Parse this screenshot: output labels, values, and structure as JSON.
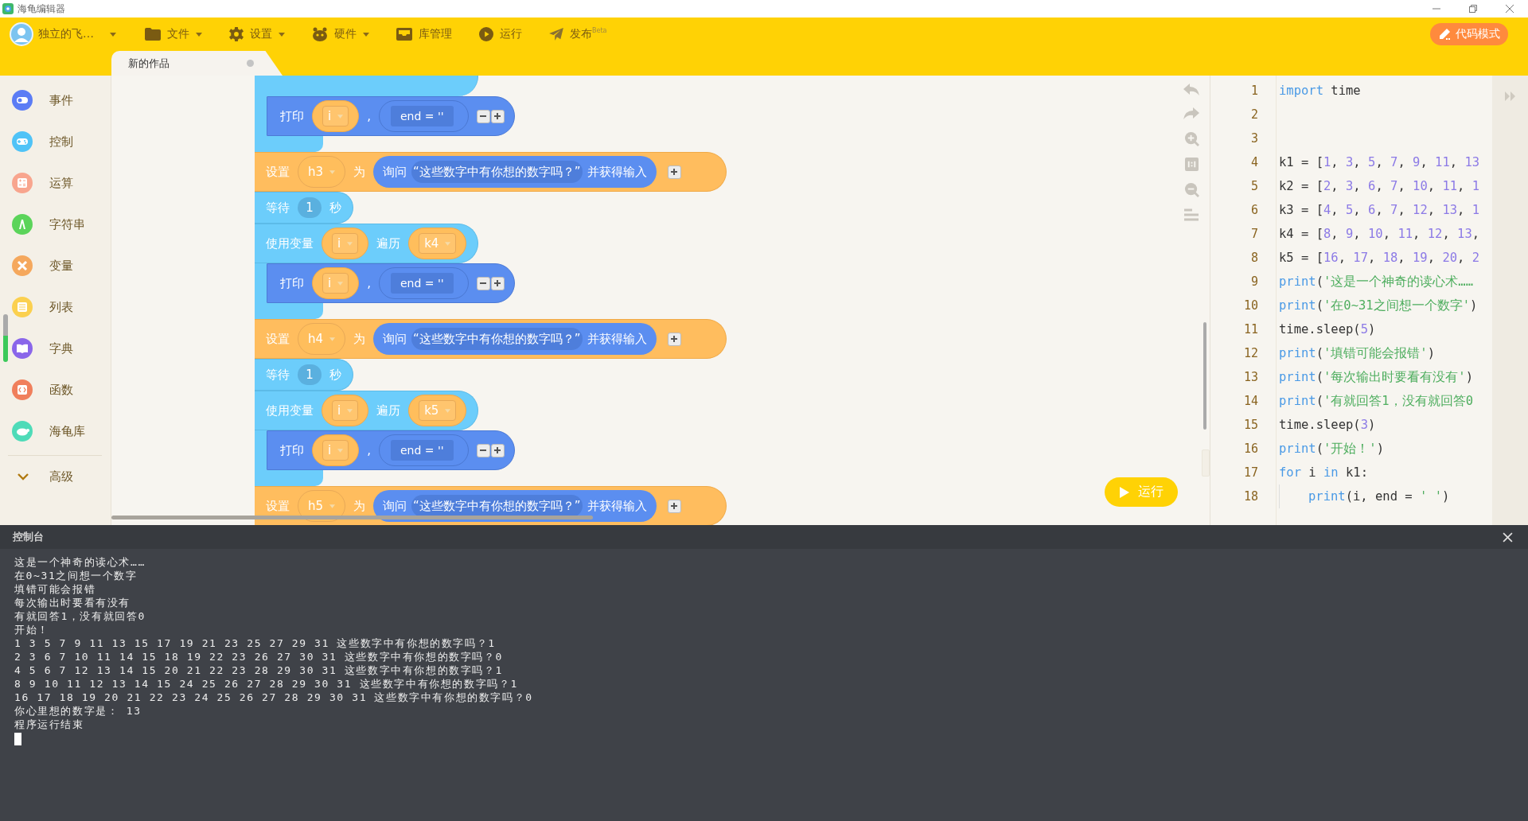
{
  "window": {
    "title": "海龟编辑器"
  },
  "toolbar": {
    "user": "独立的飞…",
    "menus": [
      {
        "label": "文件",
        "dropdown": true
      },
      {
        "label": "设置",
        "dropdown": true
      },
      {
        "label": "硬件",
        "dropdown": true
      },
      {
        "label": "库管理",
        "dropdown": false
      },
      {
        "label": "运行",
        "dropdown": false
      },
      {
        "label": "发布$^{Beta}$",
        "dropdown": false
      }
    ],
    "mode_button": "代码模式"
  },
  "tabs": [
    {
      "label": "新的作品",
      "selected": true
    }
  ],
  "sidebar": {
    "items": [
      {
        "label": "事件",
        "color": "#5b7cf5"
      },
      {
        "label": "控制",
        "color": "#4fc3f7"
      },
      {
        "label": "运算",
        "color": "#f8a58e"
      },
      {
        "label": "字符串",
        "color": "#5bd45a"
      },
      {
        "label": "变量",
        "color": "#f5a85d"
      },
      {
        "label": "列表",
        "color": "#fbd04f"
      },
      {
        "label": "字典",
        "color": "#8a66ea"
      },
      {
        "label": "函数",
        "color": "#f07f5c"
      },
      {
        "label": "海龟库",
        "color": "#4edbb8"
      }
    ],
    "more": "高级"
  },
  "blocks": [
    {
      "kind": "loop_tail",
      "body": [
        {
          "kind": "print",
          "label": "打印",
          "var": "i",
          "sep": ",",
          "end": "end = ''"
        }
      ]
    },
    {
      "kind": "set",
      "label": "设置",
      "var": "h3",
      "to": "为",
      "ask": "询问",
      "prompt": "“这些数字中有你想的数字吗？”",
      "suffix": "并获得输入"
    },
    {
      "kind": "wait",
      "label": "等待",
      "value": "1",
      "unit": "秒"
    },
    {
      "kind": "loop",
      "label": "使用变量",
      "var": "i",
      "over": "遍历",
      "list": "k4",
      "body": [
        {
          "kind": "print",
          "label": "打印",
          "var": "i",
          "sep": ",",
          "end": "end = ''"
        }
      ]
    },
    {
      "kind": "set",
      "label": "设置",
      "var": "h4",
      "to": "为",
      "ask": "询问",
      "prompt": "“这些数字中有你想的数字吗？”",
      "suffix": "并获得输入"
    },
    {
      "kind": "wait",
      "label": "等待",
      "value": "1",
      "unit": "秒"
    },
    {
      "kind": "loop",
      "label": "使用变量",
      "var": "i",
      "over": "遍历",
      "list": "k5",
      "body": [
        {
          "kind": "print",
          "label": "打印",
          "var": "i",
          "sep": ",",
          "end": "end = ''"
        }
      ]
    },
    {
      "kind": "set",
      "label": "设置",
      "var": "h5",
      "to": "为",
      "ask": "询问",
      "prompt": "“这些数字中有你想的数字吗？”",
      "suffix": "并获得输入"
    }
  ],
  "run_button": "运行",
  "code": {
    "lines": [
      {
        "number": "1",
        "tokens": [
          {
            "kind": "kw",
            "text": "import"
          },
          {
            "kind": "p",
            "text": " time"
          }
        ]
      },
      {
        "number": "2"
      },
      {
        "number": "3"
      },
      {
        "number": "4",
        "tokens": [
          {
            "kind": "p",
            "text": "k1 = ["
          },
          {
            "kind": "n",
            "text": "1"
          },
          {
            "kind": "p",
            "text": ", "
          },
          {
            "kind": "n",
            "text": "3"
          },
          {
            "kind": "p",
            "text": ", "
          },
          {
            "kind": "n",
            "text": "5"
          },
          {
            "kind": "p",
            "text": ", "
          },
          {
            "kind": "n",
            "text": "7"
          },
          {
            "kind": "p",
            "text": ", "
          },
          {
            "kind": "n",
            "text": "9"
          },
          {
            "kind": "p",
            "text": ", "
          },
          {
            "kind": "n",
            "text": "11"
          },
          {
            "kind": "p",
            "text": ", "
          },
          {
            "kind": "n",
            "text": "13"
          }
        ]
      },
      {
        "number": "5",
        "tokens": [
          {
            "kind": "p",
            "text": "k2 = ["
          },
          {
            "kind": "n",
            "text": "2"
          },
          {
            "kind": "p",
            "text": ", "
          },
          {
            "kind": "n",
            "text": "3"
          },
          {
            "kind": "p",
            "text": ", "
          },
          {
            "kind": "n",
            "text": "6"
          },
          {
            "kind": "p",
            "text": ", "
          },
          {
            "kind": "n",
            "text": "7"
          },
          {
            "kind": "p",
            "text": ", "
          },
          {
            "kind": "n",
            "text": "10"
          },
          {
            "kind": "p",
            "text": ", "
          },
          {
            "kind": "n",
            "text": "11"
          },
          {
            "kind": "p",
            "text": ", "
          },
          {
            "kind": "n",
            "text": "1"
          }
        ]
      },
      {
        "number": "6",
        "tokens": [
          {
            "kind": "p",
            "text": "k3 = ["
          },
          {
            "kind": "n",
            "text": "4"
          },
          {
            "kind": "p",
            "text": ", "
          },
          {
            "kind": "n",
            "text": "5"
          },
          {
            "kind": "p",
            "text": ", "
          },
          {
            "kind": "n",
            "text": "6"
          },
          {
            "kind": "p",
            "text": ", "
          },
          {
            "kind": "n",
            "text": "7"
          },
          {
            "kind": "p",
            "text": ", "
          },
          {
            "kind": "n",
            "text": "12"
          },
          {
            "kind": "p",
            "text": ", "
          },
          {
            "kind": "n",
            "text": "13"
          },
          {
            "kind": "p",
            "text": ", "
          },
          {
            "kind": "n",
            "text": "1"
          }
        ]
      },
      {
        "number": "7",
        "tokens": [
          {
            "kind": "p",
            "text": "k4 = ["
          },
          {
            "kind": "n",
            "text": "8"
          },
          {
            "kind": "p",
            "text": ", "
          },
          {
            "kind": "n",
            "text": "9"
          },
          {
            "kind": "p",
            "text": ", "
          },
          {
            "kind": "n",
            "text": "10"
          },
          {
            "kind": "p",
            "text": ", "
          },
          {
            "kind": "n",
            "text": "11"
          },
          {
            "kind": "p",
            "text": ", "
          },
          {
            "kind": "n",
            "text": "12"
          },
          {
            "kind": "p",
            "text": ", "
          },
          {
            "kind": "n",
            "text": "13"
          },
          {
            "kind": "p",
            "text": ","
          }
        ]
      },
      {
        "number": "8",
        "tokens": [
          {
            "kind": "p",
            "text": "k5 = ["
          },
          {
            "kind": "n",
            "text": "16"
          },
          {
            "kind": "p",
            "text": ", "
          },
          {
            "kind": "n",
            "text": "17"
          },
          {
            "kind": "p",
            "text": ", "
          },
          {
            "kind": "n",
            "text": "18"
          },
          {
            "kind": "p",
            "text": ", "
          },
          {
            "kind": "n",
            "text": "19"
          },
          {
            "kind": "p",
            "text": ", "
          },
          {
            "kind": "n",
            "text": "20"
          },
          {
            "kind": "p",
            "text": ", "
          },
          {
            "kind": "n",
            "text": "2"
          }
        ]
      },
      {
        "number": "9",
        "tokens": [
          {
            "kind": "kw",
            "text": "print"
          },
          {
            "kind": "p",
            "text": "("
          },
          {
            "kind": "s",
            "text": "'这是一个神奇的读心术……"
          }
        ]
      },
      {
        "number": "10",
        "tokens": [
          {
            "kind": "kw",
            "text": "print"
          },
          {
            "kind": "p",
            "text": "("
          },
          {
            "kind": "s",
            "text": "'在0~31之间想一个数字'"
          },
          {
            "kind": "p",
            "text": ")"
          }
        ]
      },
      {
        "number": "11",
        "tokens": [
          {
            "kind": "p",
            "text": "time.sleep("
          },
          {
            "kind": "n",
            "text": "5"
          },
          {
            "kind": "p",
            "text": ")"
          }
        ]
      },
      {
        "number": "12",
        "tokens": [
          {
            "kind": "kw",
            "text": "print"
          },
          {
            "kind": "p",
            "text": "("
          },
          {
            "kind": "s",
            "text": "'填错可能会报错'"
          },
          {
            "kind": "p",
            "text": ")"
          }
        ]
      },
      {
        "number": "13",
        "tokens": [
          {
            "kind": "kw",
            "text": "print"
          },
          {
            "kind": "p",
            "text": "("
          },
          {
            "kind": "s",
            "text": "'每次输出时要看有没有'"
          },
          {
            "kind": "p",
            "text": ")"
          }
        ]
      },
      {
        "number": "14",
        "tokens": [
          {
            "kind": "kw",
            "text": "print"
          },
          {
            "kind": "p",
            "text": "("
          },
          {
            "kind": "s",
            "text": "'有就回答1，没有就回答0"
          }
        ]
      },
      {
        "number": "15",
        "tokens": [
          {
            "kind": "p",
            "text": "time.sleep("
          },
          {
            "kind": "n",
            "text": "3"
          },
          {
            "kind": "p",
            "text": ")"
          }
        ]
      },
      {
        "number": "16",
        "tokens": [
          {
            "kind": "kw",
            "text": "print"
          },
          {
            "kind": "p",
            "text": "("
          },
          {
            "kind": "s",
            "text": "'开始！'"
          },
          {
            "kind": "p",
            "text": ")"
          }
        ]
      },
      {
        "number": "17",
        "tokens": [
          {
            "kind": "kw",
            "text": "for"
          },
          {
            "kind": "p",
            "text": " i "
          },
          {
            "kind": "kw",
            "text": "in"
          },
          {
            "kind": "p",
            "text": " k1:"
          }
        ]
      },
      {
        "number": "18",
        "indent": true,
        "tokens": [
          {
            "kind": "kw",
            "text": "print"
          },
          {
            "kind": "p",
            "text": "(i, end = "
          },
          {
            "kind": "s",
            "text": "' '"
          },
          {
            "kind": "p",
            "text": ")"
          }
        ]
      }
    ]
  },
  "console": {
    "title": "控制台",
    "lines": [
      "这是一个神奇的读心术……",
      "在0~31之间想一个数字",
      "填错可能会报错",
      "每次输出时要看有没有",
      "有就回答1，没有就回答0",
      "开始！",
      "1 3 5 7 9 11 13 15 17 19 21 23 25 27 29 31 这些数字中有你想的数字吗？1",
      "2 3 6 7 10 11 14 15 18 19 22 23 26 27 30 31 这些数字中有你想的数字吗？0",
      "4 5 6 7 12 13 14 15 20 21 22 23 28 29 30 31 这些数字中有你想的数字吗？1",
      "8 9 10 11 12 13 14 15 24 25 26 27 28 29 30 31 这些数字中有你想的数字吗？1",
      "16 17 18 19 20 21 22 23 24 25 26 27 28 29 30 31 这些数字中有你想的数字吗？0",
      "你心里想的数字是： 13",
      "程序运行结束"
    ],
    "cursor": true
  }
}
